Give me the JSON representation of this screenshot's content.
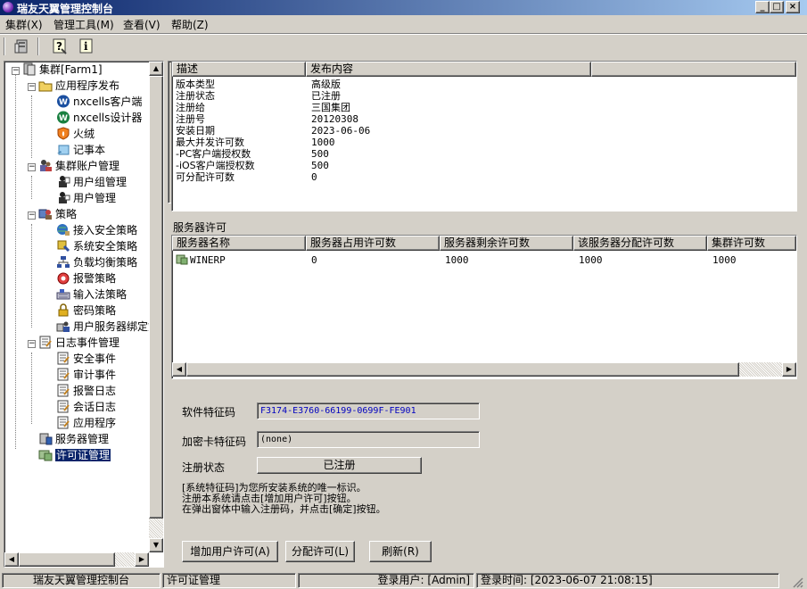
{
  "window": {
    "title": "瑞友天翼管理控制台"
  },
  "menus": [
    "集群(X)",
    "管理工具(M)",
    "查看(V)",
    "帮助(Z)"
  ],
  "toolbar": {
    "icons": [
      "server-icon",
      "help-icon",
      "info-icon"
    ]
  },
  "tree": {
    "root": "集群[Farm1]",
    "app_publish": {
      "label": "应用程序发布",
      "children": [
        "nxcells客户端",
        "nxcells设计器",
        "火绒",
        "记事本"
      ]
    },
    "accounts": {
      "label": "集群账户管理",
      "children": [
        "用户组管理",
        "用户管理"
      ]
    },
    "policies": {
      "label": "策略",
      "children": [
        "接入安全策略",
        "系统安全策略",
        "负载均衡策略",
        "报警策略",
        "输入法策略",
        "密码策略",
        "用户服务器绑定策"
      ]
    },
    "logs": {
      "label": "日志事件管理",
      "children": [
        "安全事件",
        "审计事件",
        "报警日志",
        "会话日志",
        "应用程序"
      ]
    },
    "server_mgmt": "服务器管理",
    "license_mgmt": "许可证管理"
  },
  "info_list": {
    "headers": [
      "描述",
      "发布内容"
    ],
    "rows": [
      [
        "版本类型",
        "高级版"
      ],
      [
        "注册状态",
        "已注册"
      ],
      [
        "注册给",
        "三国集团"
      ],
      [
        "注册号",
        "20120308"
      ],
      [
        "安装日期",
        "2023-06-06"
      ],
      [
        "最大并发许可数",
        "1000"
      ],
      [
        "-PC客户端授权数",
        "500"
      ],
      [
        "-iOS客户端授权数",
        "500"
      ],
      [
        "可分配许可数",
        "0"
      ]
    ]
  },
  "server_license": {
    "section_title": "服务器许可",
    "headers": [
      "服务器名称",
      "服务器占用许可数",
      "服务器剩余许可数",
      "该服务器分配许可数",
      "集群许可数"
    ],
    "rows": [
      [
        "WINERP",
        "0",
        "1000",
        "1000",
        "1000"
      ]
    ]
  },
  "software_code": {
    "label": "软件特征码",
    "value": "F3174-E3760-66199-0699F-FE901"
  },
  "card_code": {
    "label": "加密卡特征码",
    "value": "(none)"
  },
  "reg_status": {
    "label": "注册状态",
    "value": "已注册"
  },
  "notes": [
    "[系统特征码]为您所安装系统的唯一标识。",
    "注册本系统请点击[增加用户许可]按钮。",
    "在弹出窗体中输入注册码，并点击[确定]按钮。"
  ],
  "buttons": {
    "add": "增加用户许可(A)",
    "assign": "分配许可(L)",
    "refresh": "刷新(R)"
  },
  "status": {
    "app": "瑞友天翼管理控制台",
    "current": "许可证管理",
    "user": "登录用户: [Admin]",
    "time": "登录时间: [2023-06-07 21:08:15]"
  },
  "colors": {
    "titlebar": "#0a246a",
    "selection": "#0a246a",
    "face": "#d4d0c8",
    "code_text": "#0000c0"
  }
}
